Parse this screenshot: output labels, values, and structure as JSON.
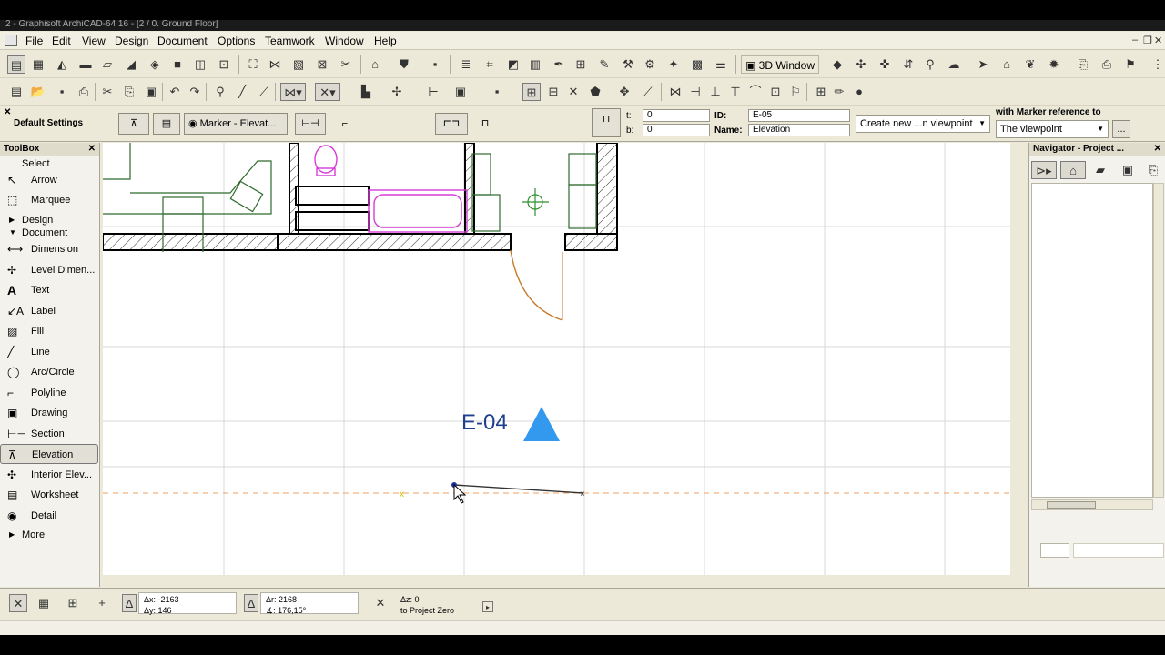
{
  "window": {
    "title": "2 - Graphisoft ArchiCAD-64 16 - [2 / 0. Ground Floor]"
  },
  "menu": [
    "File",
    "Edit",
    "View",
    "Design",
    "Document",
    "Options",
    "Teamwork",
    "Window",
    "Help"
  ],
  "toolbar": {
    "three_d_window_label": "3D Window"
  },
  "infobox": {
    "default_settings_label": "Default Settings",
    "marker_label": "Marker - Elevat...",
    "t_label": "t:",
    "t_value": "0",
    "b_label": "b:",
    "b_value": "0",
    "id_label": "ID:",
    "id_value": "E-05",
    "name_label": "Name:",
    "name_value": "Elevation",
    "create_new_dropdown": "Create new ...n viewpoint",
    "marker_ref_label": "with Marker reference to",
    "viewpoint_dropdown": "The viewpoint",
    "more_button": "..."
  },
  "toolbox": {
    "title": "ToolBox",
    "select_header": "Select",
    "tools_top": [
      {
        "label": "Arrow",
        "icon": "arrow-icon"
      },
      {
        "label": "Marquee",
        "icon": "marquee-icon"
      }
    ],
    "design_header": "Design",
    "document_header": "Document",
    "tools_doc": [
      {
        "label": "Dimension",
        "icon": "dimension-icon"
      },
      {
        "label": "Level Dimen...",
        "icon": "level-dimension-icon"
      },
      {
        "label": "Text",
        "icon": "text-icon"
      },
      {
        "label": "Label",
        "icon": "label-icon"
      },
      {
        "label": "Fill",
        "icon": "fill-icon"
      },
      {
        "label": "Line",
        "icon": "line-icon"
      },
      {
        "label": "Arc/Circle",
        "icon": "arc-circle-icon"
      },
      {
        "label": "Polyline",
        "icon": "polyline-icon"
      },
      {
        "label": "Drawing",
        "icon": "drawing-icon"
      },
      {
        "label": "Section",
        "icon": "section-icon"
      },
      {
        "label": "Elevation",
        "icon": "elevation-icon"
      },
      {
        "label": "Interior Elev...",
        "icon": "interior-elevation-icon"
      },
      {
        "label": "Worksheet",
        "icon": "worksheet-icon"
      },
      {
        "label": "Detail",
        "icon": "detail-icon"
      }
    ],
    "more_header": "More",
    "selected_tool": "Elevation"
  },
  "canvas": {
    "marker_text": "E-04",
    "marker_color": "#3399ee",
    "marker_text_color": "#1f3f8f"
  },
  "navigator": {
    "title": "Navigator - Project ..."
  },
  "status": {
    "dx_label": "Δx: -2163",
    "dy_label": "Δy: 146",
    "dr_label": "Δr: 2168",
    "angle_label": "∡: 176,15°",
    "dz_label": "Δz: 0",
    "project_zero_label": "to Project Zero"
  }
}
